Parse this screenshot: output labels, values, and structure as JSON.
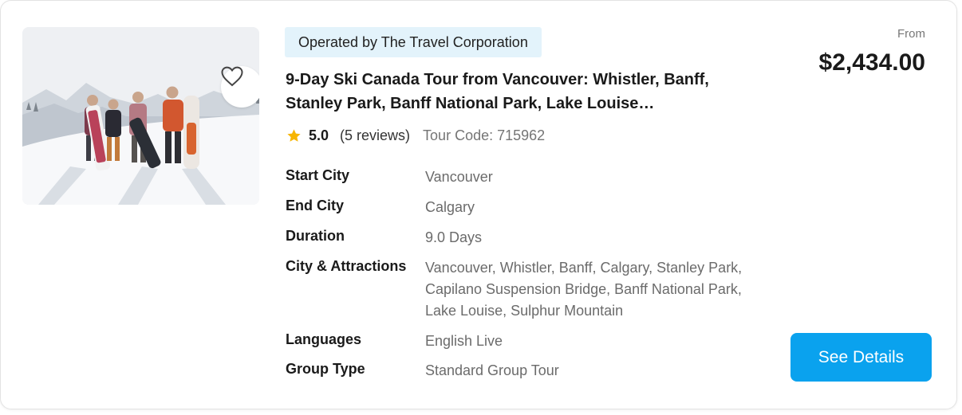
{
  "card": {
    "operator": "Operated by The Travel Corporation",
    "title": "9-Day Ski Canada Tour from Vancouver: Whistler, Banff, Stanley Park, Banff National Park, Lake Louise…",
    "rating": {
      "score": "5.0",
      "reviews": "(5 reviews)",
      "tour_code": "Tour Code: 715962"
    },
    "details": [
      {
        "label": "Start City",
        "value": "Vancouver"
      },
      {
        "label": "End City",
        "value": "Calgary"
      },
      {
        "label": "Duration",
        "value": "9.0 Days"
      },
      {
        "label": "City & Attractions",
        "value": "Vancouver, Whistler, Banff, Calgary, Stanley Park, Capilano Suspension Bridge, Banff National Park, Lake Louise, Sulphur Mountain"
      },
      {
        "label": "Languages",
        "value": "English Live"
      },
      {
        "label": "Group Type",
        "value": "Standard Group Tour"
      }
    ],
    "price": {
      "from_label": "From",
      "amount": "$2,434.00"
    },
    "cta_label": "See Details",
    "icons": {
      "favorite": "heart-outline-icon",
      "rating": "star-icon"
    },
    "colors": {
      "accent": "#0aa2ee",
      "operator_badge_bg": "#e3f3fb",
      "star": "#f7b500"
    }
  }
}
